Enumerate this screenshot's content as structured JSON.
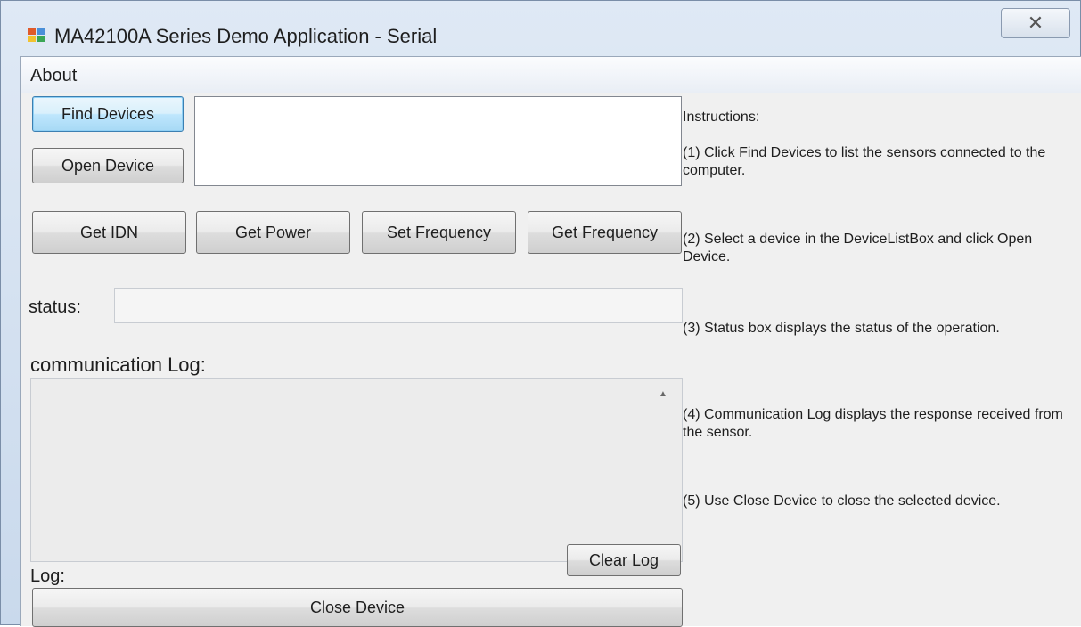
{
  "window": {
    "title": "MA42100A Series Demo Application - Serial",
    "close_glyph": "✕"
  },
  "menu": {
    "items": [
      "About"
    ]
  },
  "buttons": {
    "find_devices": "Find Devices",
    "open_device": "Open Device",
    "get_idn": "Get IDN",
    "get_power": "Get Power",
    "set_frequency": "Set Frequency",
    "get_frequency": "Get Frequency",
    "clear_log": "Clear Log",
    "close_device": "Close Device"
  },
  "labels": {
    "status": "status:",
    "communication_log": "communication Log:",
    "log": "Log:"
  },
  "status": {
    "value": ""
  },
  "device_list": {
    "items": []
  },
  "communication_log": {
    "value": ""
  },
  "instructions": {
    "heading": "Instructions:",
    "step1": "(1) Click Find Devices to list the sensors connected to the computer.",
    "step2": "(2) Select a device in the DeviceListBox and click Open Device.",
    "step3": "(3) Status box displays the status of the operation.",
    "step4": "(4) Communication Log displays the response received from the sensor.",
    "step5": "(5) Use Close Device to close the selected device."
  },
  "icons": {
    "app": "app-window-icon",
    "close": "close-icon"
  },
  "colors": {
    "focus_border": "#3c7fb1",
    "window_frame": "#c9d9ec",
    "client_bg": "#f0f0f0"
  }
}
